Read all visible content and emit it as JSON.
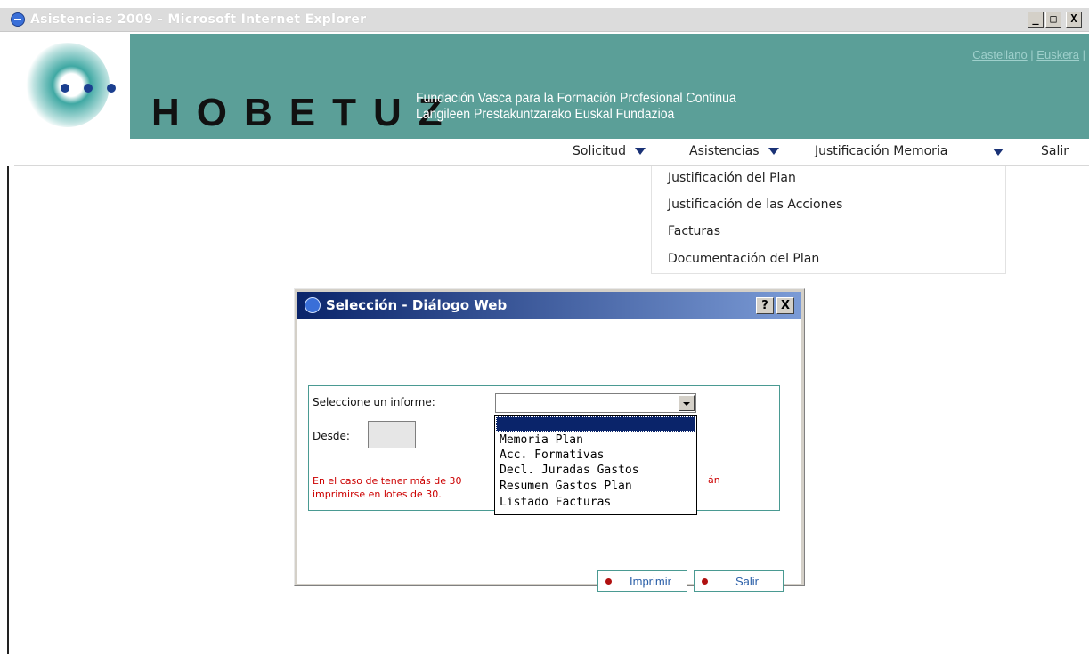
{
  "window": {
    "title": "Asistencias 2009 - Microsoft Internet Explorer",
    "minimize": "_",
    "maximize": "□",
    "close": "X"
  },
  "header": {
    "lang_es": "Castellano",
    "lang_sep": " | ",
    "lang_eu": "Euskera",
    "lang_trail": " |",
    "brand": "HOBETUZ",
    "foundation_es": "Fundación Vasca para la Formación Profesional Continua",
    "foundation_eu": "Langileen Prestakuntzarako Euskal Fundazioa"
  },
  "menu": {
    "items": [
      {
        "label": "Solicitud"
      },
      {
        "label": "Asistencias"
      },
      {
        "label": "Justificación Memoria"
      },
      {
        "label": "Salir"
      }
    ],
    "submenu": [
      "Justificación del Plan",
      "Justificación de las Acciones",
      "Facturas",
      "Documentación del Plan"
    ]
  },
  "dialog": {
    "title": "Selección - Diálogo Web",
    "help": "?",
    "close": "X",
    "select_label": "Seleccione un informe:",
    "select_value": "",
    "desde_label": "Desde:",
    "note_line1": "En el caso de tener más de 30",
    "note_line2": "imprimirse en lotes de 30.",
    "note_tail": "án",
    "options": [
      "Memoria Plan",
      "Acc. Formativas",
      "Decl. Juradas Gastos",
      "Resumen Gastos Plan",
      "Listado Facturas"
    ],
    "print_label": "Imprimir",
    "exit_label": "Salir"
  },
  "colors": {
    "teal": "#5b9f98",
    "title_blue": "#0a246a",
    "note_red": "#cc0000"
  }
}
